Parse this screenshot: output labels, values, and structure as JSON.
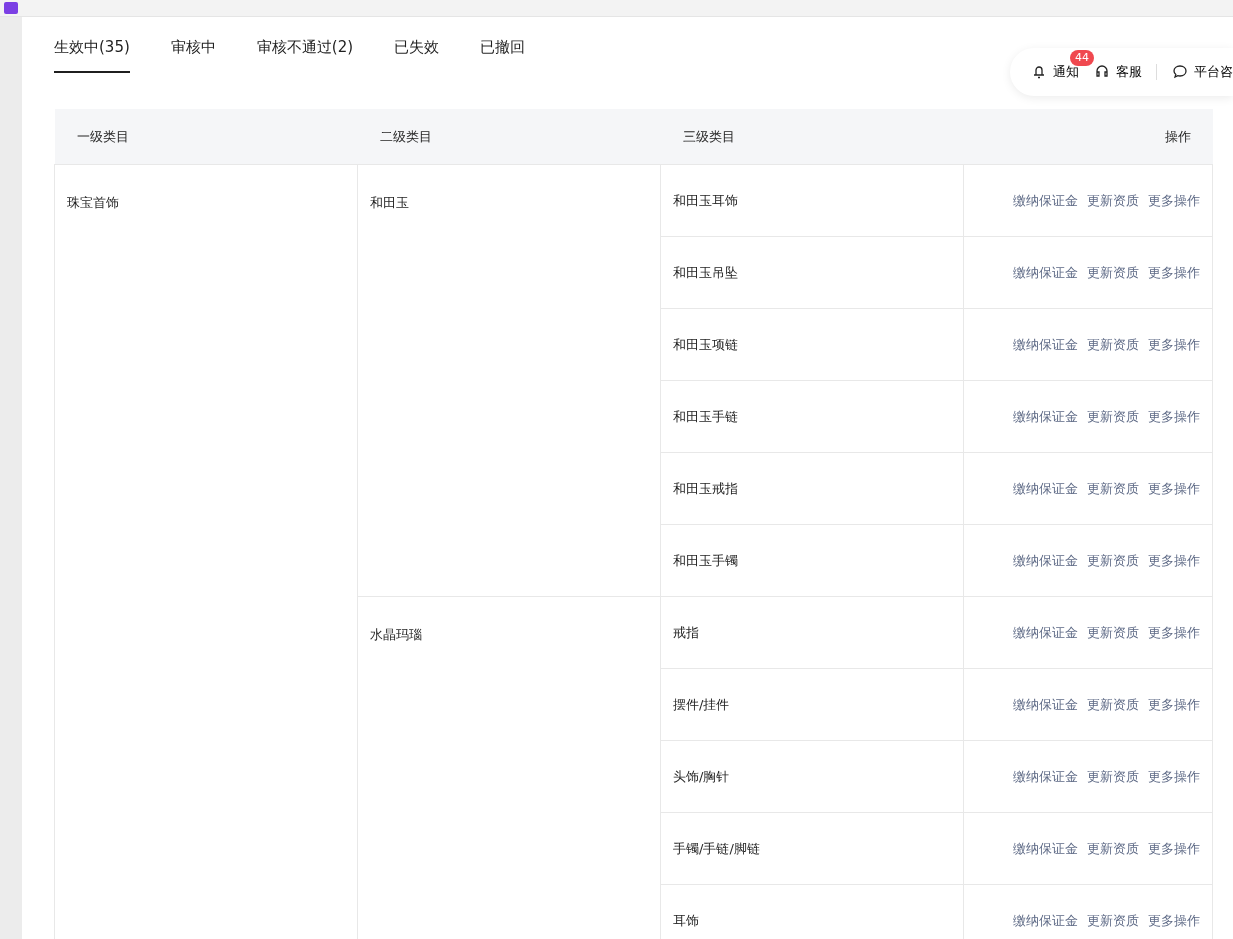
{
  "tabs": [
    {
      "label": "生效中(35)",
      "selected": true
    },
    {
      "label": "审核中",
      "selected": false
    },
    {
      "label": "审核不通过(2)",
      "selected": false
    },
    {
      "label": "已失效",
      "selected": false
    },
    {
      "label": "已撤回",
      "selected": false
    }
  ],
  "toolbar": {
    "items": [
      {
        "kind": "bell",
        "label": "通知",
        "badge": "44"
      },
      {
        "kind": "headset",
        "label": "客服"
      },
      {
        "kind": "chat",
        "label": "平台咨"
      }
    ]
  },
  "table": {
    "columns": [
      "一级类目",
      "二级类目",
      "三级类目",
      "操作"
    ],
    "categories": [
      {
        "name": "珠宝首饰",
        "children": [
          {
            "name": "和田玉",
            "children": [
              {
                "name": "和田玉耳饰",
                "actions": [
                  "缴纳保证金",
                  "更新资质",
                  "更多操作"
                ]
              },
              {
                "name": "和田玉吊坠",
                "actions": [
                  "缴纳保证金",
                  "更新资质",
                  "更多操作"
                ]
              },
              {
                "name": "和田玉项链",
                "actions": [
                  "缴纳保证金",
                  "更新资质",
                  "更多操作"
                ]
              },
              {
                "name": "和田玉手链",
                "actions": [
                  "缴纳保证金",
                  "更新资质",
                  "更多操作"
                ]
              },
              {
                "name": "和田玉戒指",
                "actions": [
                  "缴纳保证金",
                  "更新资质",
                  "更多操作"
                ]
              },
              {
                "name": "和田玉手镯",
                "actions": [
                  "缴纳保证金",
                  "更新资质",
                  "更多操作"
                ]
              }
            ]
          },
          {
            "name": "水晶玛瑙",
            "children": [
              {
                "name": "戒指",
                "actions": [
                  "缴纳保证金",
                  "更新资质",
                  "更多操作"
                ]
              },
              {
                "name": "摆件/挂件",
                "actions": [
                  "缴纳保证金",
                  "更新资质",
                  "更多操作"
                ]
              },
              {
                "name": "头饰/胸针",
                "actions": [
                  "缴纳保证金",
                  "更新资质",
                  "更多操作"
                ]
              },
              {
                "name": "手镯/手链/脚链",
                "actions": [
                  "缴纳保证金",
                  "更新资质",
                  "更多操作"
                ]
              },
              {
                "name": "耳饰",
                "actions": [
                  "缴纳保证金",
                  "更新资质",
                  "更多操作"
                ]
              }
            ]
          }
        ]
      }
    ]
  }
}
